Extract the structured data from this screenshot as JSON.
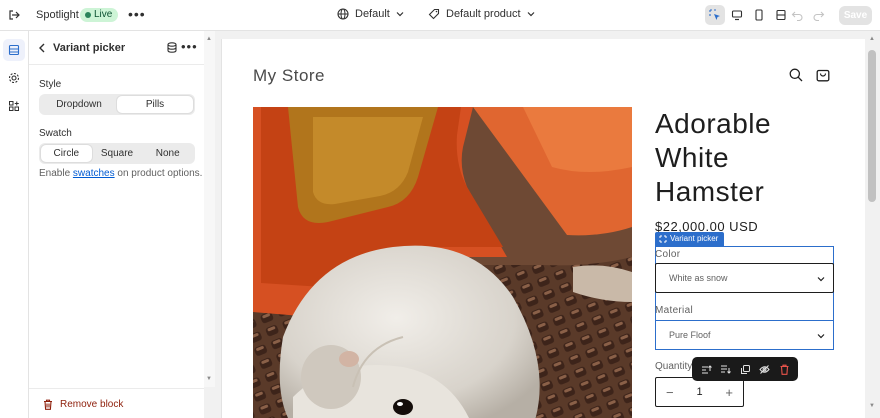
{
  "topbar": {
    "app_name": "Spotlight",
    "status": "Live",
    "theme_selector": "Default",
    "template_selector": "Default product",
    "save_label": "Save"
  },
  "panel": {
    "title": "Variant picker",
    "style_label": "Style",
    "style_options": [
      "Dropdown",
      "Pills"
    ],
    "style_selected": "Dropdown",
    "swatch_label": "Swatch",
    "swatch_options": [
      "Circle",
      "Square",
      "None"
    ],
    "swatch_selected": "Circle",
    "hint_prefix": "Enable ",
    "hint_link": "swatches",
    "hint_suffix": " on product options.",
    "remove_label": "Remove block"
  },
  "preview": {
    "store_name": "My Store",
    "product_title": "Adorable White Hamster",
    "price": "$22,000.00 USD",
    "block_tag": "Variant picker",
    "color_label": "Color",
    "color_value": "White as snow",
    "material_label": "Material",
    "material_value": "Pure Floof",
    "quantity_label": "Quantity",
    "quantity_value": "1",
    "qty_minus": "−",
    "qty_plus": "+"
  },
  "colors": {
    "accent": "#2c6ecb",
    "live_badge_bg": "#cdf4d6",
    "danger": "#8e1f0b"
  },
  "icons": {
    "rail": [
      "sections-icon",
      "settings-icon",
      "apps-icon"
    ],
    "toolbar": [
      "move-up-icon",
      "move-down-icon",
      "duplicate-icon",
      "hide-icon",
      "delete-icon"
    ]
  }
}
